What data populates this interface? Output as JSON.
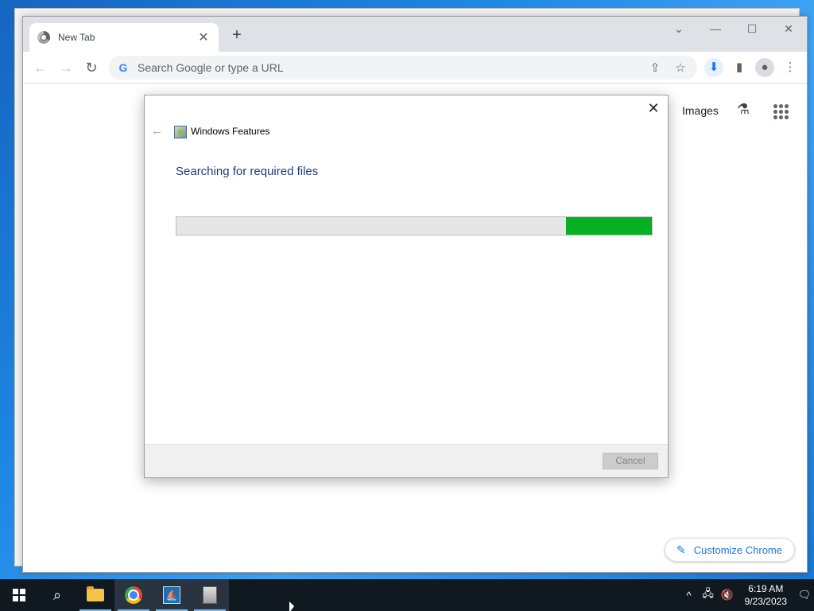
{
  "browser": {
    "tab": {
      "title": "New Tab",
      "close": "✕"
    },
    "new_tab": "+",
    "window_controls": {
      "dropdown": "⌄",
      "minimize": "—",
      "maximize": "☐",
      "close": "✕"
    },
    "nav": {
      "back": "←",
      "forward": "→",
      "reload": "↻"
    },
    "omnibox": {
      "placeholder": "Search Google or type a URL",
      "google_glyph": "G"
    },
    "toolbar_icons": {
      "share": "⇪",
      "bookmark": "☆",
      "download": "⬇",
      "side_panel": "▮",
      "profile": "●",
      "menu": "⋮"
    }
  },
  "ntp": {
    "images_link": "Images",
    "labs": "⚗",
    "customize_label": "Customize Chrome",
    "customize_icon": "✎"
  },
  "dialog": {
    "title": "Windows Features",
    "back": "←",
    "close": "✕",
    "heading": "Searching for required files",
    "progress": {
      "start_fraction": 0.82,
      "end_fraction": 1.0,
      "color": "#06b025"
    },
    "cancel_label": "Cancel"
  },
  "taskbar": {
    "search_glyph": "⌕",
    "tray": {
      "chevron": "^",
      "network": "🖧",
      "volume": "🔇"
    },
    "clock": {
      "time": "6:19 AM",
      "date": "9/23/2023"
    },
    "notifications": "🗨"
  }
}
